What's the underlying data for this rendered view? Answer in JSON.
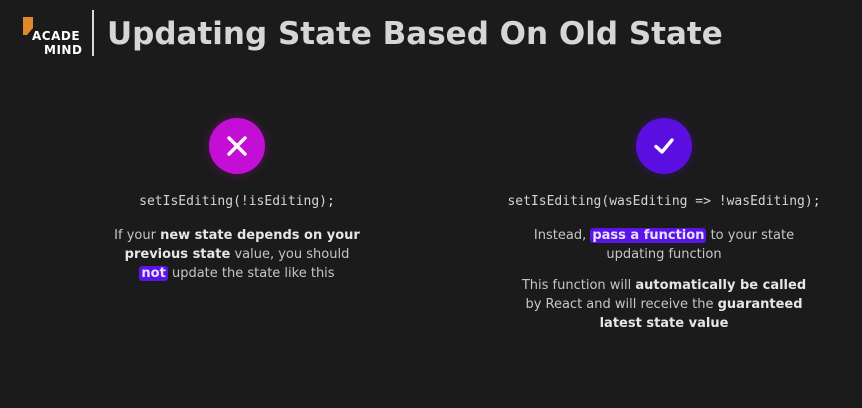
{
  "header": {
    "logo_line1": "ACADE",
    "logo_line2": "MIND",
    "title": "Updating State Based On Old State"
  },
  "left": {
    "icon": "close-icon",
    "code": "setIsEditing(!isEditing);",
    "p_1": "If your ",
    "p_bold_1": "new state depends on your previous state",
    "p_2": " value, you should ",
    "p_highlight": "not",
    "p_3": " update the state like this"
  },
  "right": {
    "icon": "check-icon",
    "code": "setIsEditing(wasEditing => !wasEditing);",
    "p1_1": "Instead, ",
    "p1_highlight": "pass a function",
    "p1_2": " to your state updating function",
    "p2_1": "This function will ",
    "p2_bold_1": "automatically be called",
    "p2_2": " by React and will receive the ",
    "p2_bold_2": "guaranteed latest state value"
  },
  "colors": {
    "background": "#1b1b1b",
    "bad_badge": "#c30ed6",
    "good_badge": "#5a0fe0",
    "highlight": "#5b14e6",
    "logo_accent": "#e0892b"
  }
}
